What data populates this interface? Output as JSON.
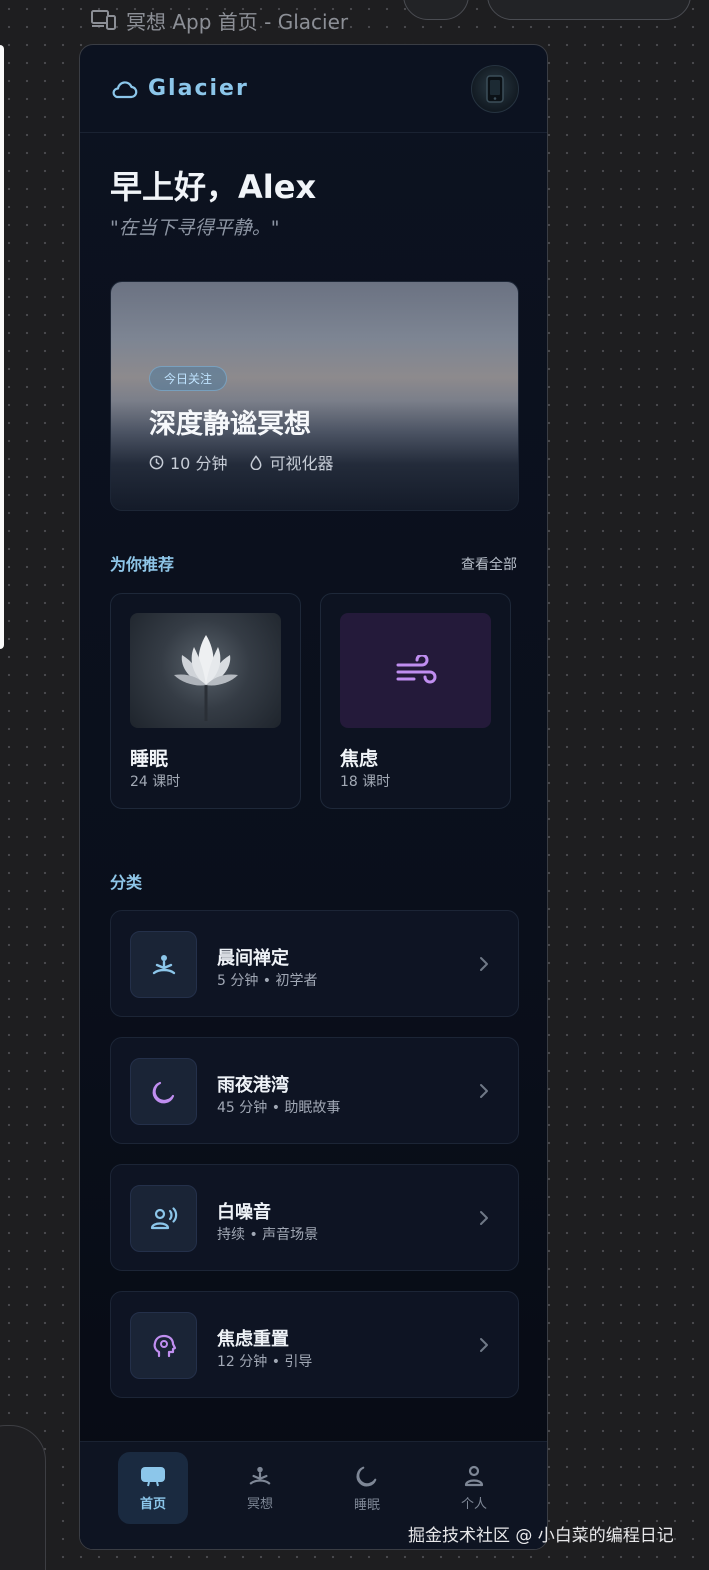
{
  "frame_title": "冥想 App 首页 - Glacier",
  "header": {
    "brand": "Glacier"
  },
  "greeting": "早上好，Alex",
  "quote": "\"在当下寻得平静。\"",
  "hero": {
    "tag": "今日关注",
    "title": "深度静谧冥想",
    "duration": "10 分钟",
    "mode": "可视化器"
  },
  "recommend": {
    "title": "为你推荐",
    "see_all": "查看全部",
    "cards": [
      {
        "title": "睡眠",
        "sub": "24 课时",
        "icon": "lotus-image"
      },
      {
        "title": "焦虑",
        "sub": "18 课时",
        "icon": "wind-icon"
      }
    ]
  },
  "categories": {
    "title": "分类",
    "items": [
      {
        "title": "晨间禅定",
        "sub": "5 分钟 • 初学者",
        "icon": "meditation-icon"
      },
      {
        "title": "雨夜港湾",
        "sub": "45 分钟 • 助眠故事",
        "icon": "moon-icon"
      },
      {
        "title": "白噪音",
        "sub": "持续 • 声音场景",
        "icon": "voice-icon"
      },
      {
        "title": "焦虑重置",
        "sub": "12 分钟 • 引导",
        "icon": "brain-icon"
      }
    ]
  },
  "nav": [
    {
      "label": "首页",
      "icon": "home-icon",
      "active": true
    },
    {
      "label": "冥想",
      "icon": "meditation-icon",
      "active": false
    },
    {
      "label": "睡眠",
      "icon": "moon-icon",
      "active": false
    },
    {
      "label": "个人",
      "icon": "person-icon",
      "active": false
    }
  ],
  "watermark": "掘金技术社区 @ 小白菜的编程日记",
  "colors": {
    "accent": "#8cc6ea",
    "background": "#0a0f1b",
    "purple": "#c08ef0"
  }
}
